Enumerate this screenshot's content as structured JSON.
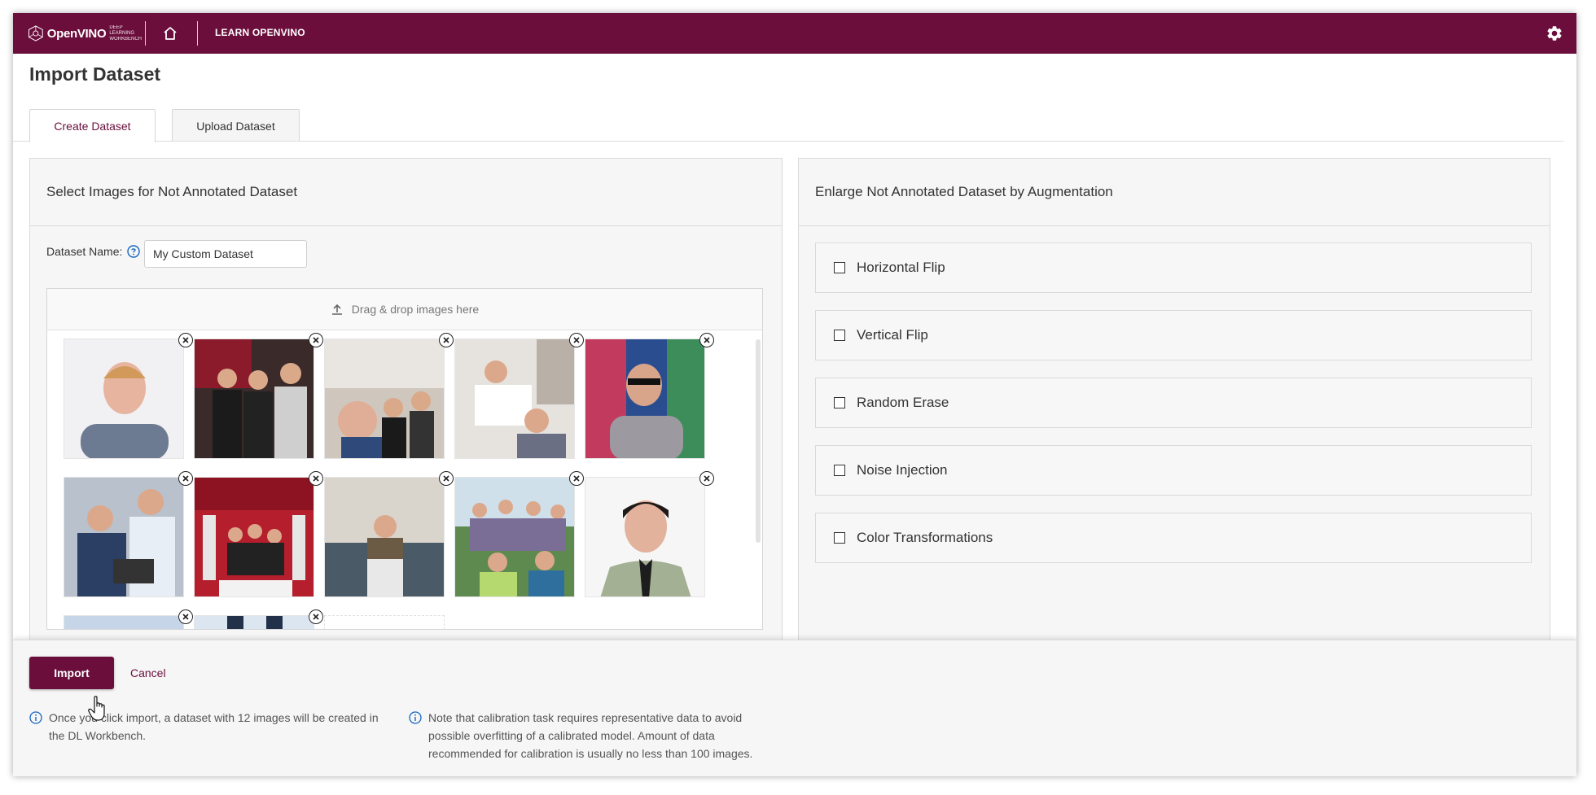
{
  "header": {
    "logo_main": "OpenVINO",
    "logo_sub_1": "Deep Learning",
    "logo_sub_2": "Workbench",
    "learn_link": "LEARN OPENVINO",
    "home_icon": "home-icon",
    "settings_icon": "gear-icon",
    "bg_color": "#6b0e3c"
  },
  "page": {
    "title": "Import Dataset"
  },
  "tabs": [
    {
      "label": "Create Dataset",
      "active": true
    },
    {
      "label": "Upload Dataset",
      "active": false
    }
  ],
  "left_panel": {
    "title": "Select Images for Not Annotated Dataset",
    "dataset_name_label": "Dataset Name:",
    "dataset_name_value": "My Custom Dataset",
    "dropzone_text": "Drag & drop images here",
    "image_count": 12
  },
  "right_panel": {
    "title": "Enlarge Not Annotated Dataset by Augmentation",
    "options": [
      {
        "label": "Horizontal Flip",
        "checked": false
      },
      {
        "label": "Vertical Flip",
        "checked": false
      },
      {
        "label": "Random Erase",
        "checked": false
      },
      {
        "label": "Noise Injection",
        "checked": false
      },
      {
        "label": "Color Transformations",
        "checked": false
      }
    ]
  },
  "footer": {
    "import_label": "Import",
    "cancel_label": "Cancel",
    "hint_1": "Once you click import, a dataset with 12 images will be created in the DL Workbench.",
    "hint_2": "Note that calibration task requires representative data to avoid possible overfitting of a calibrated model. Amount of data recommended for calibration is usually no less than 100 images."
  },
  "colors": {
    "accent": "#6b0e3c",
    "info": "#1565c0"
  }
}
